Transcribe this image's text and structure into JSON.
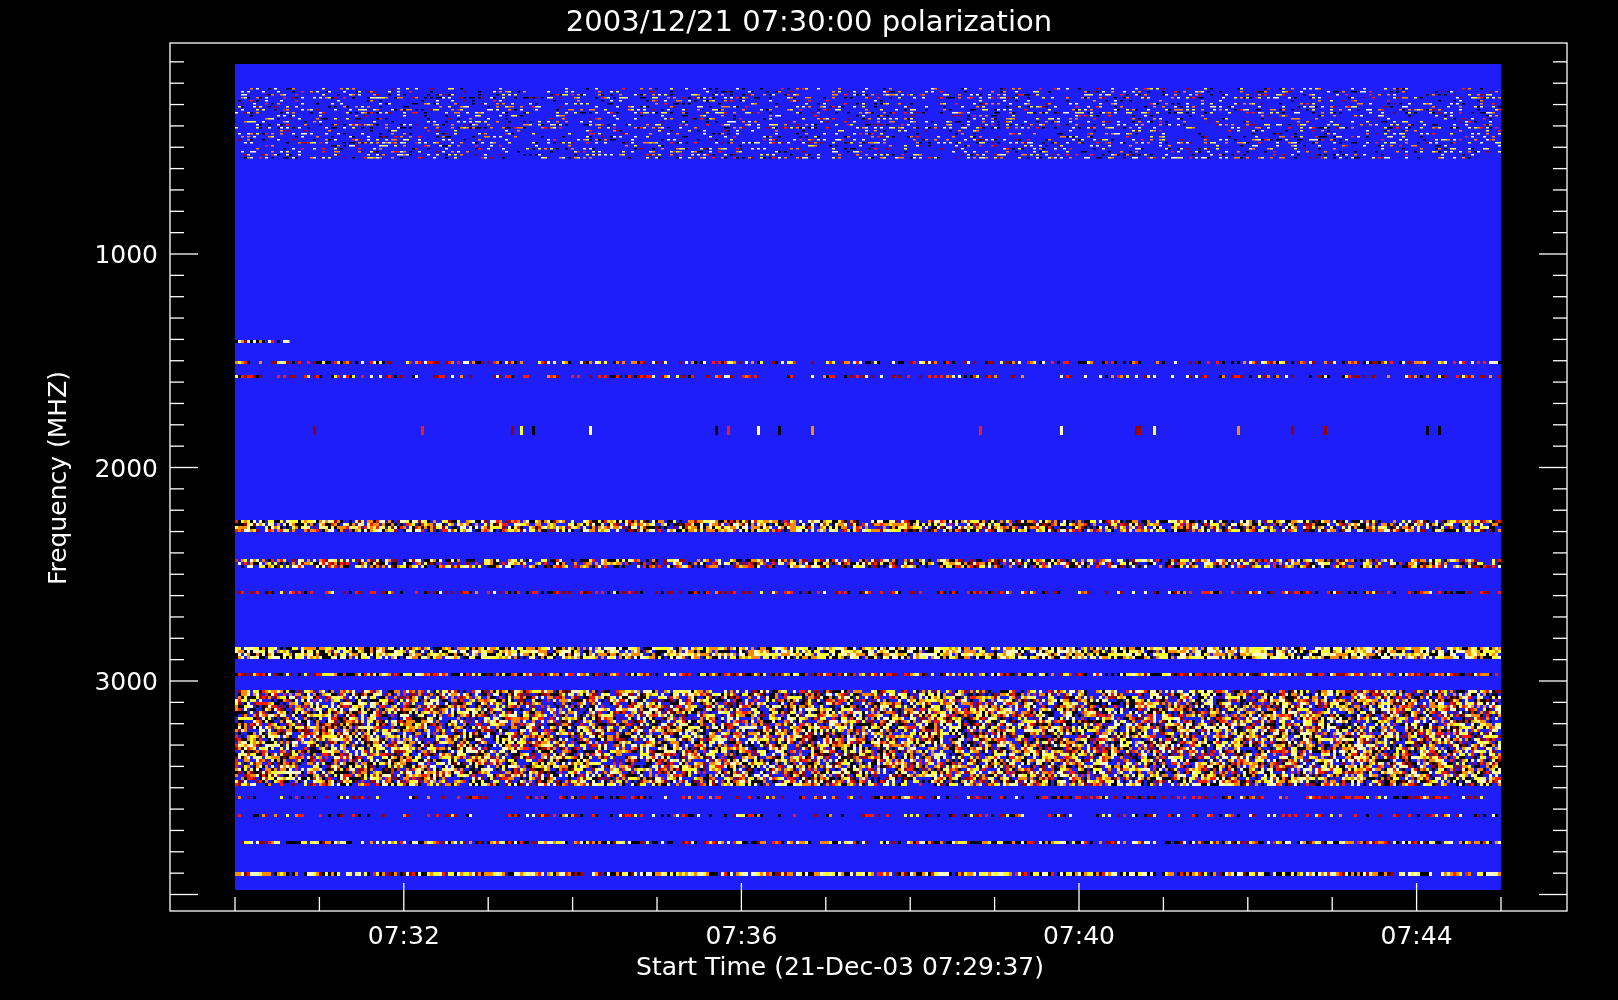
{
  "title": "2003/12/21 07:30:00 polarization",
  "y_axis": {
    "label": "Frequency (MHZ)",
    "ticks": [
      "1000",
      "2000",
      "3000"
    ]
  },
  "x_axis": {
    "label": "Start Time (21-Dec-03 07:29:37)",
    "ticks": [
      "07:32",
      "07:36",
      "07:40",
      "07:44"
    ]
  }
}
